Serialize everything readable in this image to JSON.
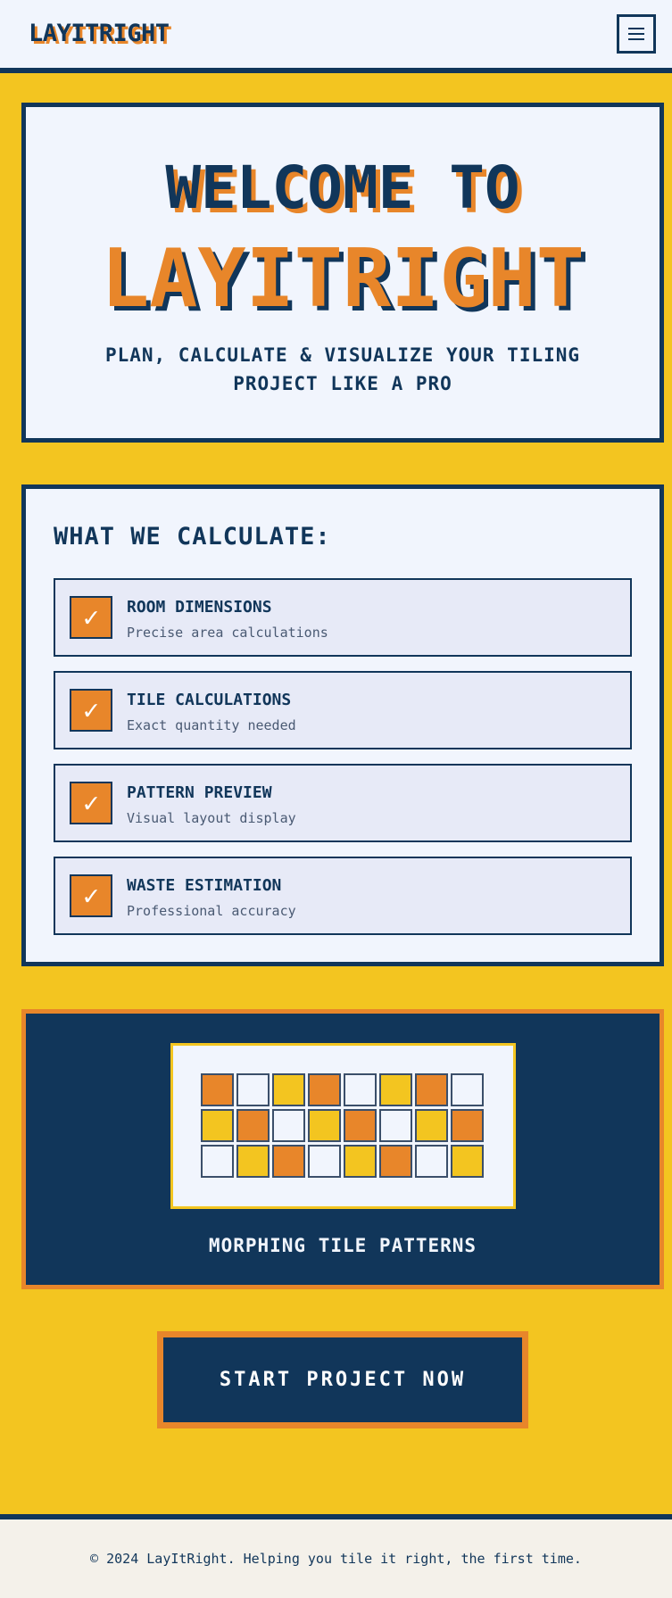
{
  "header": {
    "logo": "LAYITRIGHT",
    "menu_icon": "hamburger-menu-icon"
  },
  "hero": {
    "welcome": "WELCOME TO",
    "brand": "LAYITRIGHT",
    "subtitle": "PLAN, CALCULATE & VISUALIZE YOUR TILING PROJECT LIKE A PRO"
  },
  "features": {
    "title": "WHAT WE CALCULATE:",
    "check_glyph": "✓",
    "items": [
      {
        "title": "ROOM DIMENSIONS",
        "desc": "Precise area calculations"
      },
      {
        "title": "TILE CALCULATIONS",
        "desc": "Exact quantity needed"
      },
      {
        "title": "PATTERN PREVIEW",
        "desc": "Visual layout display"
      },
      {
        "title": "WASTE ESTIMATION",
        "desc": "Professional accuracy"
      }
    ]
  },
  "pattern": {
    "label": "MORPHING TILE PATTERNS",
    "colors": {
      "o": "#e8862a",
      "w": "#f1f5fd",
      "y": "#f3c520"
    },
    "rows": [
      [
        "o",
        "w",
        "y",
        "o",
        "w",
        "y",
        "o",
        "w"
      ],
      [
        "y",
        "o",
        "w",
        "y",
        "o",
        "w",
        "y",
        "o"
      ],
      [
        "w",
        "y",
        "o",
        "w",
        "y",
        "o",
        "w",
        "y"
      ]
    ]
  },
  "cta": {
    "label": "START PROJECT NOW"
  },
  "footer": {
    "text": "© 2024 LayItRight. Helping you tile it right, the first time."
  }
}
